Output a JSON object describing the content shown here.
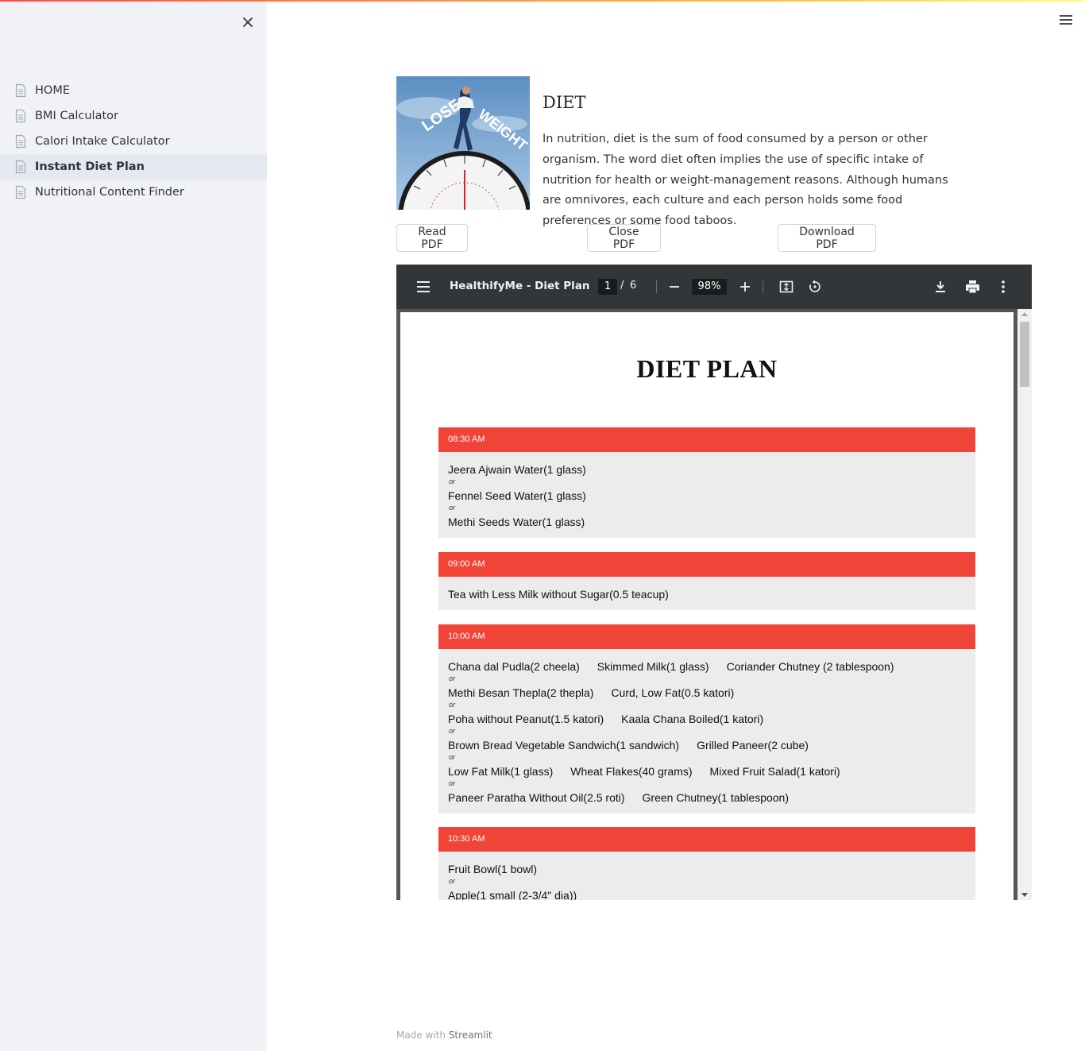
{
  "sidebar": {
    "close_icon": "close-icon",
    "items": [
      {
        "label": "HOME",
        "icon": "document-icon",
        "active": false
      },
      {
        "label": "BMI Calculator",
        "icon": "document-icon",
        "active": false
      },
      {
        "label": "Calori Intake Calculator",
        "icon": "document-icon",
        "active": false
      },
      {
        "label": "Instant Diet Plan",
        "icon": "document-icon",
        "active": true
      },
      {
        "label": "Nutritional Content Finder",
        "icon": "document-icon",
        "active": false
      }
    ]
  },
  "header": {
    "menu_icon": "hamburger-menu-icon"
  },
  "hero": {
    "image_text_left": "LOSE",
    "image_text_right": "WEIGHT",
    "title": "DIET",
    "description": "In nutrition, diet is the sum of food consumed by a person or other organism. The word diet often implies the use of specific intake of nutrition for health or weight-management reasons. Although humans are omnivores, each culture and each person holds some food preferences or some food taboos."
  },
  "buttons": {
    "read": "Read PDF",
    "close": "Close PDF",
    "download": "Download PDF"
  },
  "pdf_viewer": {
    "title": "HealthifyMe - Diet Plan",
    "current_page": "1",
    "page_separator": "/",
    "total_pages": "6",
    "zoom": "98%",
    "accent_color": "#f04438",
    "document": {
      "heading": "DIET PLAN",
      "or_label": "or",
      "slots": [
        {
          "time": "08:30 AM",
          "options": [
            [
              "Jeera Ajwain Water(1 glass)"
            ],
            [
              "Fennel Seed Water(1 glass)"
            ],
            [
              "Methi Seeds Water(1 glass)"
            ]
          ]
        },
        {
          "time": "09:00 AM",
          "options": [
            [
              "Tea with Less Milk without Sugar(0.5 teacup)"
            ]
          ]
        },
        {
          "time": "10:00 AM",
          "options": [
            [
              "Chana dal Pudla(2 cheela)",
              "Skimmed Milk(1 glass)",
              "Coriander Chutney (2 tablespoon)"
            ],
            [
              "Methi Besan Thepla(2 thepla)",
              "Curd, Low Fat(0.5 katori)"
            ],
            [
              "Poha without Peanut(1.5 katori)",
              "Kaala Chana Boiled(1 katori)"
            ],
            [
              "Brown Bread Vegetable Sandwich(1 sandwich)",
              "Grilled Paneer(2 cube)"
            ],
            [
              "Low Fat Milk(1 glass)",
              "Wheat Flakes(40 grams)",
              "Mixed Fruit Salad(1 katori)"
            ],
            [
              "Paneer Paratha Without Oil(2.5 roti)",
              "Green Chutney(1 tablespoon)"
            ]
          ]
        },
        {
          "time": "10:30 AM",
          "options": [
            [
              "Fruit Bowl(1 bowl)"
            ],
            [
              "Apple(1 small (2-3/4\" dia))"
            ]
          ]
        }
      ]
    }
  },
  "footer": {
    "prefix": "Made with",
    "brand": "Streamlit"
  }
}
